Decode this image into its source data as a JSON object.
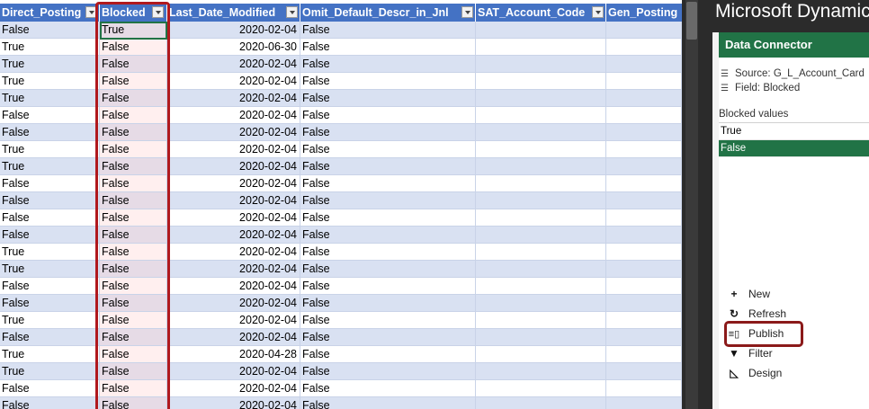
{
  "sheet": {
    "headers": {
      "direct_posting": "Direct_Posting",
      "blocked": "Blocked",
      "last_date_modified": "Last_Date_Modified",
      "omit_default_descr": "Omit_Default_Descr_in_Jnl",
      "sat_account_code": "SAT_Account_Code",
      "gen_posting": "Gen_Posting"
    },
    "rows": [
      {
        "direct_posting": "False",
        "blocked": "True",
        "last_date_modified": "2020-02-04",
        "omit_default_descr": "False"
      },
      {
        "direct_posting": "True",
        "blocked": "False",
        "last_date_modified": "2020-06-30",
        "omit_default_descr": "False"
      },
      {
        "direct_posting": "True",
        "blocked": "False",
        "last_date_modified": "2020-02-04",
        "omit_default_descr": "False"
      },
      {
        "direct_posting": "True",
        "blocked": "False",
        "last_date_modified": "2020-02-04",
        "omit_default_descr": "False"
      },
      {
        "direct_posting": "True",
        "blocked": "False",
        "last_date_modified": "2020-02-04",
        "omit_default_descr": "False"
      },
      {
        "direct_posting": "False",
        "blocked": "False",
        "last_date_modified": "2020-02-04",
        "omit_default_descr": "False"
      },
      {
        "direct_posting": "False",
        "blocked": "False",
        "last_date_modified": "2020-02-04",
        "omit_default_descr": "False"
      },
      {
        "direct_posting": "True",
        "blocked": "False",
        "last_date_modified": "2020-02-04",
        "omit_default_descr": "False"
      },
      {
        "direct_posting": "True",
        "blocked": "False",
        "last_date_modified": "2020-02-04",
        "omit_default_descr": "False"
      },
      {
        "direct_posting": "False",
        "blocked": "False",
        "last_date_modified": "2020-02-04",
        "omit_default_descr": "False"
      },
      {
        "direct_posting": "False",
        "blocked": "False",
        "last_date_modified": "2020-02-04",
        "omit_default_descr": "False"
      },
      {
        "direct_posting": "False",
        "blocked": "False",
        "last_date_modified": "2020-02-04",
        "omit_default_descr": "False"
      },
      {
        "direct_posting": "False",
        "blocked": "False",
        "last_date_modified": "2020-02-04",
        "omit_default_descr": "False"
      },
      {
        "direct_posting": "True",
        "blocked": "False",
        "last_date_modified": "2020-02-04",
        "omit_default_descr": "False"
      },
      {
        "direct_posting": "True",
        "blocked": "False",
        "last_date_modified": "2020-02-04",
        "omit_default_descr": "False"
      },
      {
        "direct_posting": "False",
        "blocked": "False",
        "last_date_modified": "2020-02-04",
        "omit_default_descr": "False"
      },
      {
        "direct_posting": "False",
        "blocked": "False",
        "last_date_modified": "2020-02-04",
        "omit_default_descr": "False"
      },
      {
        "direct_posting": "True",
        "blocked": "False",
        "last_date_modified": "2020-02-04",
        "omit_default_descr": "False"
      },
      {
        "direct_posting": "False",
        "blocked": "False",
        "last_date_modified": "2020-02-04",
        "omit_default_descr": "False"
      },
      {
        "direct_posting": "True",
        "blocked": "False",
        "last_date_modified": "2020-04-28",
        "omit_default_descr": "False"
      },
      {
        "direct_posting": "True",
        "blocked": "False",
        "last_date_modified": "2020-02-04",
        "omit_default_descr": "False"
      },
      {
        "direct_posting": "False",
        "blocked": "False",
        "last_date_modified": "2020-02-04",
        "omit_default_descr": "False"
      },
      {
        "direct_posting": "False",
        "blocked": "False",
        "last_date_modified": "2020-02-04",
        "omit_default_descr": "False"
      }
    ]
  },
  "pane": {
    "app_title": "Microsoft Dynamics",
    "header": "Data Connector",
    "source_text": "Source: G_L_Account_Card",
    "field_text": "Field: Blocked",
    "values_label": "Blocked values",
    "values": [
      "True",
      "False"
    ],
    "selected_value": "False",
    "commands": [
      {
        "label": "New",
        "icon": "plus-icon"
      },
      {
        "label": "Refresh",
        "icon": "refresh-icon"
      },
      {
        "label": "Publish",
        "icon": "publish-icon"
      },
      {
        "label": "Filter",
        "icon": "filter-icon"
      },
      {
        "label": "Design",
        "icon": "design-icon"
      }
    ]
  },
  "colors": {
    "header_blue": "#4472c4",
    "band_blue": "#d9e1f2",
    "excel_green": "#217346",
    "highlight_red": "#b0191e"
  }
}
